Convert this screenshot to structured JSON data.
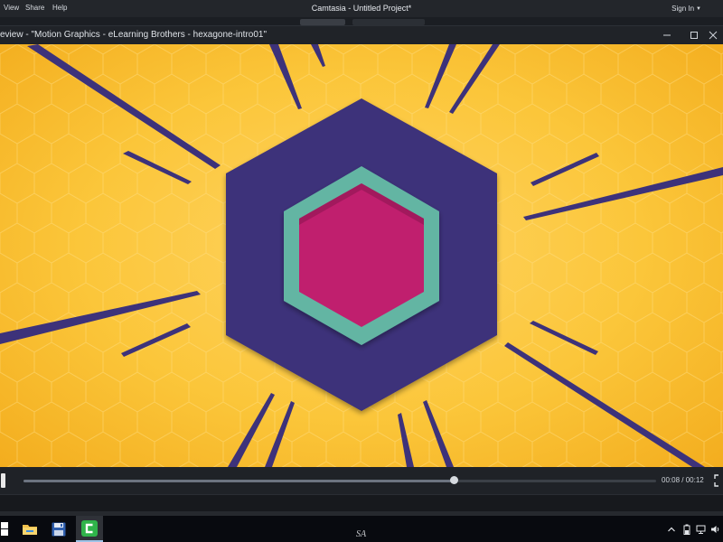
{
  "menu": {
    "items": [
      {
        "label": "View"
      },
      {
        "label": "Share"
      },
      {
        "label": "Help"
      }
    ]
  },
  "app": {
    "title": "Camtasia - Untitled Project*",
    "signin_label": "Sign In"
  },
  "preview": {
    "title": "eview - \"Motion Graphics - eLearning Brothers - hexagone-intro01\""
  },
  "icons": {
    "minimize": "minimize-icon",
    "maximize": "maximize-icon",
    "close": "close-icon",
    "fullscreen": "fullscreen-icon",
    "start": "windows-start-icon",
    "explorer": "file-explorer-icon",
    "save": "floppy-disk-icon",
    "camtasia": "camtasia-icon",
    "tray_chevron": "chevron-up-icon",
    "tray_battery": "battery-icon",
    "tray_network": "network-icon",
    "tray_volume": "volume-icon"
  },
  "playback": {
    "current_time": "00:08",
    "total_time": "00:12",
    "time_separator": " / ",
    "progress": 0.68
  },
  "taskbar": {
    "user_initials": "SA"
  },
  "colors": {
    "background_yellow": "#fbc63a",
    "hexagon_outer": "#3d327a",
    "hexagon_ring": "#63b5a3",
    "hexagon_inner": "#c01f6e",
    "spike": "#3d327a",
    "camtasia_green": "#2fb34a"
  }
}
